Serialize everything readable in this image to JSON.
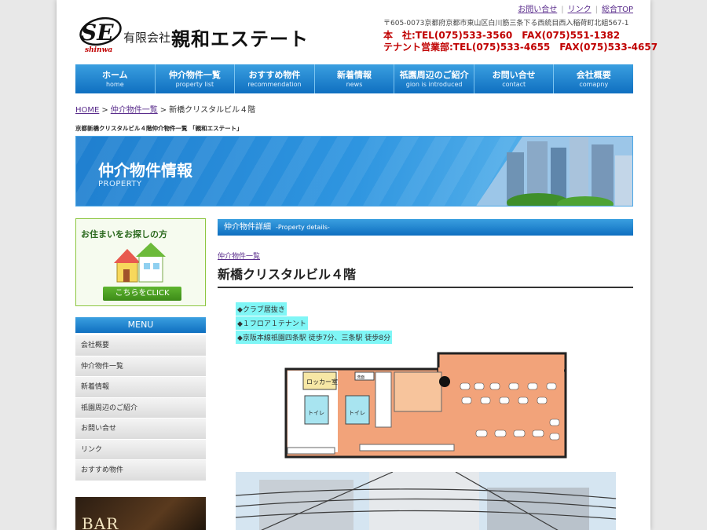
{
  "utility_links": [
    "お問い合せ",
    "リンク",
    "総合TOP"
  ],
  "header": {
    "logo_text": "SE",
    "logo_sub": "shinwa",
    "company_prefix": "有限会社",
    "company_name": "親和エステート",
    "address": "〒605-0073京都府京都市東山区白川筋三条下る西統目西入稲荷町北組567-1",
    "tel_main": "本　社:TEL(075)533-3560　FAX(075)551-1382",
    "tel_tenant": "テナント営業部:TEL(075)533-4655　FAX(075)533-4657"
  },
  "nav": [
    {
      "jp": "ホーム",
      "en": "home"
    },
    {
      "jp": "仲介物件一覧",
      "en": "property list"
    },
    {
      "jp": "おすすめ物件",
      "en": "recommendation"
    },
    {
      "jp": "新着情報",
      "en": "news"
    },
    {
      "jp": "祇園周辺のご紹介",
      "en": "gion is introduced"
    },
    {
      "jp": "お問い合せ",
      "en": "contact"
    },
    {
      "jp": "会社概要",
      "en": "comapny"
    }
  ],
  "breadcrumb": {
    "home": "HOME",
    "list": "仲介物件一覧",
    "current": "新橋クリスタルビル４階",
    "sep": ">"
  },
  "page_note": "京都新橋クリスタルビル４階仲介物件一覧 「親和エステート」",
  "banner": {
    "title": "仲介物件情報",
    "subtitle": "PROPERTY"
  },
  "sidebar": {
    "search_title": "お住まいをお探しの方",
    "search_button": "こちらをCLICK",
    "menu_title": "MENU",
    "menu_items": [
      "会社概要",
      "仲介物件一覧",
      "新着情報",
      "祇園周辺のご紹介",
      "お問い合せ",
      "リンク",
      "おすすめ物件"
    ],
    "bar_label": "BAR"
  },
  "main": {
    "section_title": "仲介物件詳細",
    "section_en": "-Property details-",
    "back_link": "仲介物件一覧",
    "property_title": "新橋クリスタルビル４階",
    "features": [
      "◆クラブ居抜き",
      "◆１フロア１テナント",
      "◆京阪本線祇園四条駅 徒歩7分、三条駅 徒歩8分"
    ],
    "floorplan_labels": {
      "locker": "ロッカー室",
      "toilet1": "トイレ",
      "toilet2": "トイレ",
      "small": "洗面"
    }
  }
}
